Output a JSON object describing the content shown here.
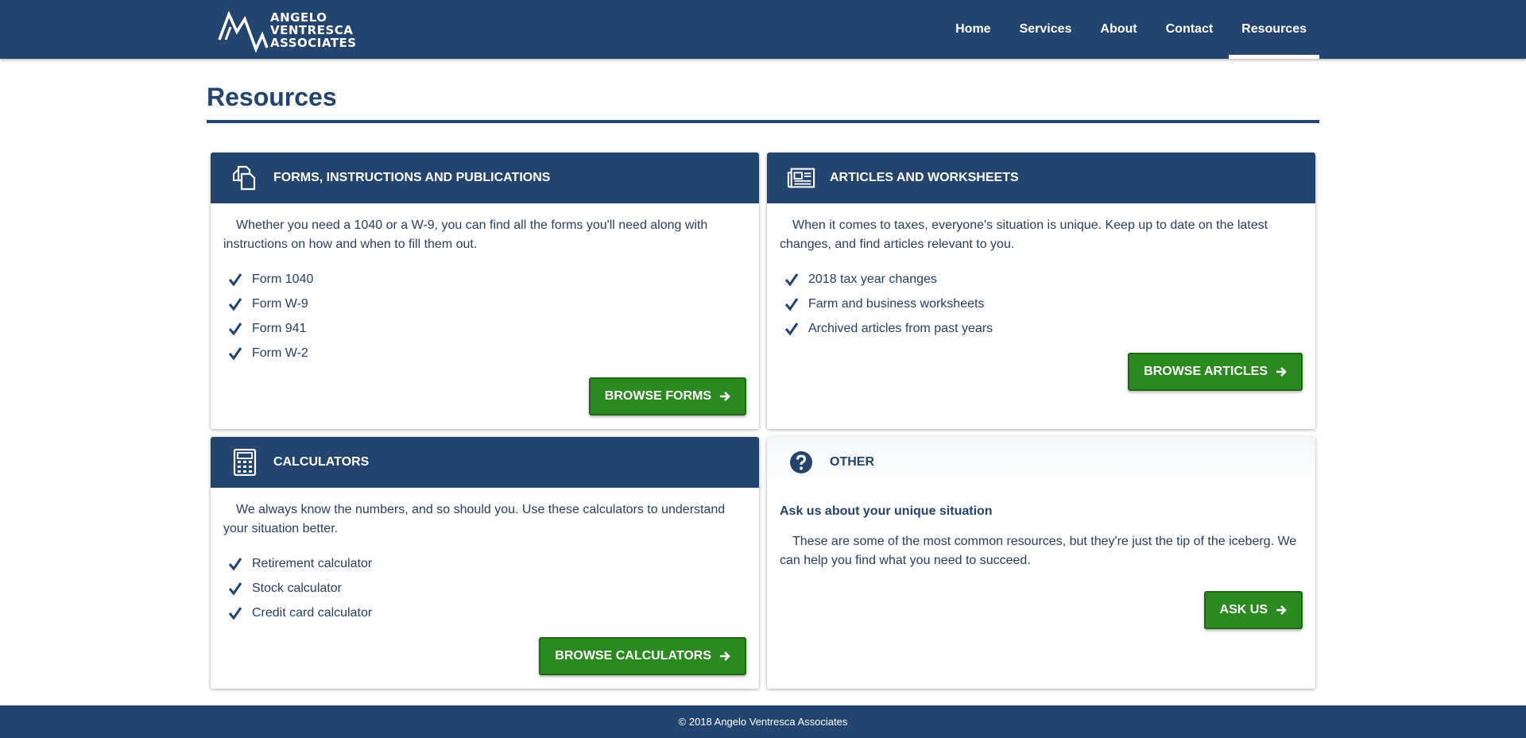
{
  "brand": {
    "logo_lines": [
      "ANGELO",
      "VENTRESCA",
      "ASSOCIATES"
    ],
    "logo_icon": "ava-mountain-logo"
  },
  "nav": {
    "items": [
      {
        "label": "Home",
        "active": false
      },
      {
        "label": "Services",
        "active": false
      },
      {
        "label": "About",
        "active": false
      },
      {
        "label": "Contact",
        "active": false
      },
      {
        "label": "Resources",
        "active": true
      }
    ]
  },
  "page": {
    "title": "Resources"
  },
  "cards": {
    "forms": {
      "icon": "documents-icon",
      "title": "FORMS, INSTRUCTIONS AND PUBLICATIONS",
      "text": "Whether you need a 1040 or a W-9, you can find all the forms you'll need along with instructions on how and when to fill them out.",
      "items": [
        "Form 1040",
        "Form W-9",
        "Form 941",
        "Form W-2"
      ],
      "button": "BROWSE FORMS"
    },
    "articles": {
      "icon": "newspaper-icon",
      "title": "ARTICLES AND WORKSHEETS",
      "text": "When it comes to taxes, everyone's situation is unique. Keep up to date on the latest changes, and find articles relevant to you.",
      "items": [
        "2018 tax year changes",
        "Farm and business worksheets",
        "Archived articles from past years"
      ],
      "button": "BROWSE ARTICLES"
    },
    "calculators": {
      "icon": "calculator-icon",
      "title": "CALCULATORS",
      "text": "We always know the numbers, and so should you. Use these calculators to understand your situation better.",
      "items": [
        "Retirement calculator",
        "Stock calculator",
        "Credit card calculator"
      ],
      "button": "BROWSE CALCULATORS"
    },
    "other": {
      "icon": "question-circle-icon",
      "title": "OTHER",
      "subtitle": "Ask us about your unique situation",
      "text": "These are some of the most common resources, but they're just the tip of the iceberg. We can help you find what you need to succeed.",
      "button": "ASK US"
    }
  },
  "footer": {
    "copyright": "© 2018 Angelo Ventresca Associates"
  },
  "colors": {
    "primary": "#23446e",
    "button": "#2b8a1f",
    "text": "#2b3f5c"
  }
}
